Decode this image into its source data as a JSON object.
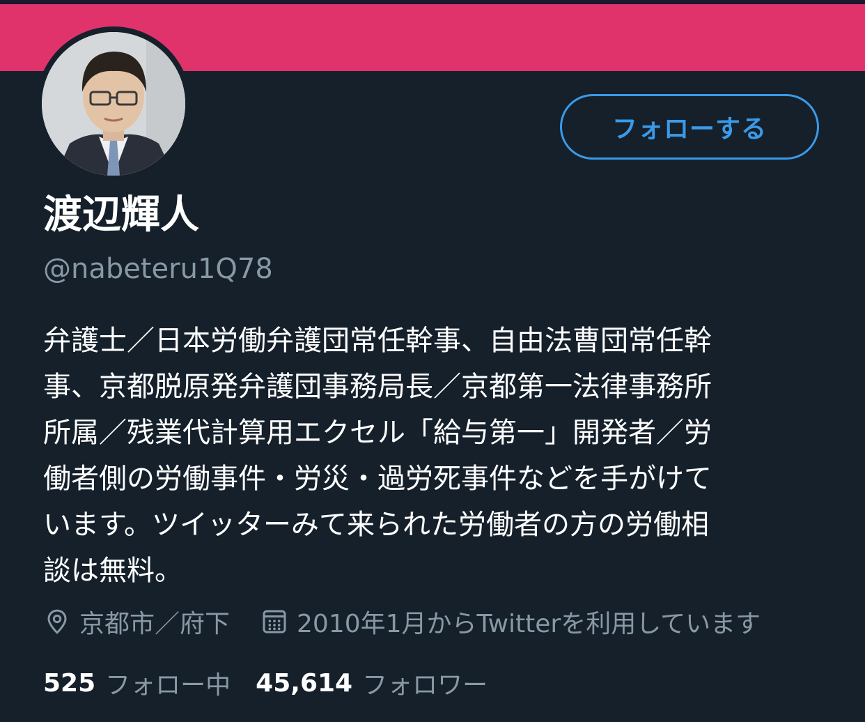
{
  "banner": {
    "color": "#e0336b"
  },
  "profile": {
    "name": "渡辺輝人",
    "handle": "@nabeteru1Q78",
    "follow_label": "フォローする",
    "bio_lines": [
      "弁護士／日本労働弁護団常任幹事、自由法曹団常任幹",
      "事、京都脱原発弁護団事務局長／京都第一法律事務所",
      "所属／残業代計算用エクセル「給与第一」開発者／労",
      "働者側の労働事件・労災・過労死事件などを手がけて",
      "います。ツイッターみて来られた労働者の方の労働相",
      "談は無料。"
    ],
    "location": "京都市／府下",
    "joined": "2010年1月からTwitterを利用しています",
    "following_count": "525",
    "following_label": "フォロー中",
    "followers_count": "45,614",
    "followers_label": "フォロワー"
  },
  "icons": {
    "location": "location-pin-icon",
    "joined": "calendar-icon"
  },
  "colors": {
    "background": "#15202b",
    "accent": "#3b9ae8",
    "secondary_text": "#8899a6"
  }
}
